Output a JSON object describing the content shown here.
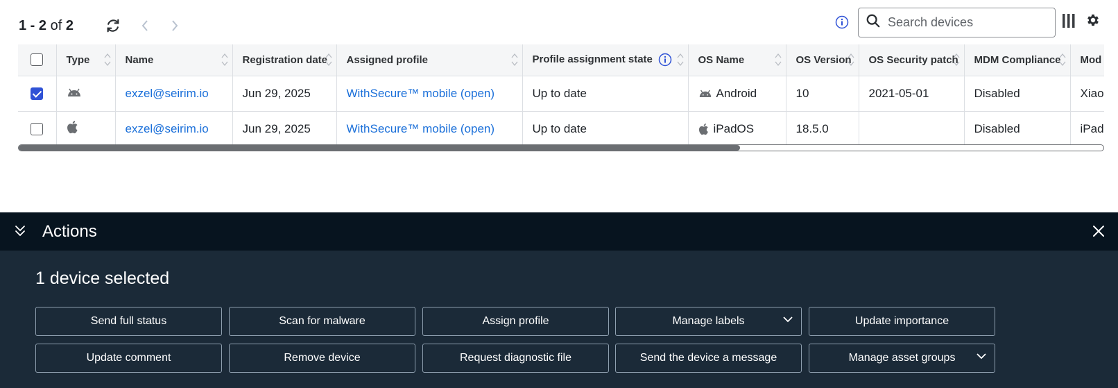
{
  "toolbar": {
    "range": "1 - 2",
    "of_word": "of",
    "total": "2",
    "search_placeholder": "Search devices",
    "icons": [
      "refresh-icon",
      "chevron-left-icon",
      "chevron-right-icon",
      "info-icon",
      "search-icon",
      "columns-icon",
      "gear-icon"
    ]
  },
  "table": {
    "columns": [
      "Type",
      "Name",
      "Registration date",
      "Assigned profile",
      "Profile assignment state",
      "OS Name",
      "OS Version",
      "OS Security patch",
      "MDM Compliance",
      "Mod"
    ],
    "rows": [
      {
        "checked": true,
        "type_icon": "android-icon",
        "name": "exzel@seirim.io",
        "registration_date": "Jun 29, 2025",
        "assigned_profile": "WithSecure™ mobile (open)",
        "assignment_state": "Up to date",
        "os_icon": "android-icon",
        "os_name": "Android",
        "os_version": "10",
        "security_patch": "2021-05-01",
        "mdm_compliance": "Disabled",
        "model": "Xiao"
      },
      {
        "checked": false,
        "type_icon": "apple-icon",
        "name": "exzel@seirim.io",
        "registration_date": "Jun 29, 2025",
        "assigned_profile": "WithSecure™ mobile (open)",
        "assignment_state": "Up to date",
        "os_icon": "apple-icon",
        "os_name": "iPadOS",
        "os_version": "18.5.0",
        "security_patch": "",
        "mdm_compliance": "Disabled",
        "model": "iPad"
      }
    ]
  },
  "actions": {
    "title": "Actions",
    "selected_text": "1 device selected",
    "buttons_row1": [
      "Send full status",
      "Scan for malware",
      "Assign profile",
      "Manage labels",
      "Update importance"
    ],
    "buttons_row2": [
      "Update comment",
      "Remove device",
      "Request diagnostic file",
      "Send the device a message",
      "Manage asset groups"
    ]
  },
  "colors": {
    "link": "#1a6fd9",
    "checkbox_accent": "#2f52d6",
    "panel_bg": "#1b2a38",
    "panel_header_bg": "#07141f"
  }
}
